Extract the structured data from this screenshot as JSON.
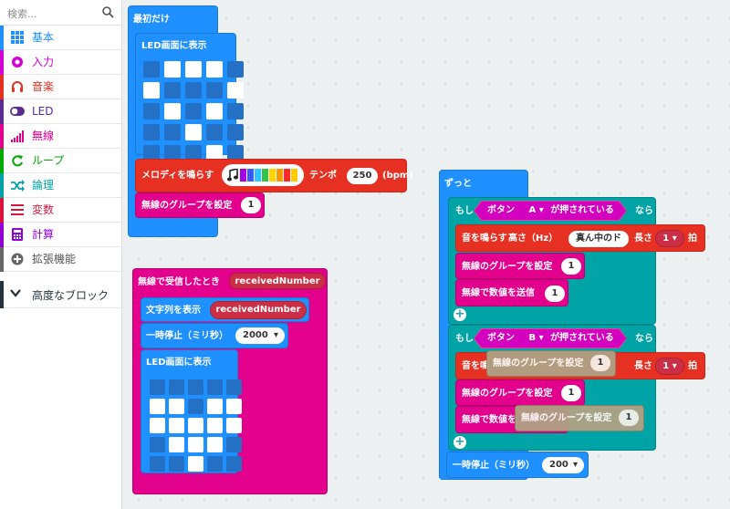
{
  "sidebar": {
    "search_placeholder": "検索...",
    "categories": [
      {
        "label": "基本",
        "color": "#1e90ff",
        "icon": "grid-icon"
      },
      {
        "label": "入力",
        "color": "#d400d4",
        "icon": "circle-dot-icon"
      },
      {
        "label": "音楽",
        "color": "#e63022",
        "icon": "headphones-icon"
      },
      {
        "label": "LED",
        "color": "#5c2d91",
        "icon": "toggle-icon"
      },
      {
        "label": "無線",
        "color": "#e3008c",
        "icon": "signal-bars-icon"
      },
      {
        "label": "ループ",
        "color": "#00aa00",
        "icon": "loop-arrow-icon"
      },
      {
        "label": "論理",
        "color": "#00a4a6",
        "icon": "shuffle-icon"
      },
      {
        "label": "変数",
        "color": "#dc143c",
        "icon": "list-lines-icon"
      },
      {
        "label": "計算",
        "color": "#9400d3",
        "icon": "calculator-icon"
      },
      {
        "label": "拡張機能",
        "color": "#666666",
        "icon": "plus-circle-icon"
      }
    ],
    "advanced_label": "高度なブロック"
  },
  "on_start": {
    "label": "最初だけ",
    "show_leds_label": "LED画面に表示",
    "leds": [
      [
        0,
        1,
        1,
        1,
        0
      ],
      [
        1,
        0,
        0,
        0,
        1
      ],
      [
        0,
        1,
        0,
        1,
        0
      ],
      [
        0,
        0,
        1,
        0,
        0
      ],
      [
        0,
        0,
        0,
        1,
        0
      ]
    ],
    "melody_label": "メロディを鳴らす",
    "tempo_label": "テンポ",
    "tempo_value": "250",
    "tempo_unit": "(bpm)",
    "set_group_label": "無線のグループを設定",
    "set_group_value": "1"
  },
  "on_received": {
    "label": "無線で受信したとき",
    "param": "receivedNumber",
    "show_string_label": "文字列を表示",
    "show_string_value": "receivedNumber",
    "pause_label": "一時停止（ミリ秒）",
    "pause_value": "2000",
    "show_leds_label": "LED画面に表示",
    "leds": [
      [
        0,
        0,
        0,
        0,
        0
      ],
      [
        1,
        1,
        0,
        1,
        1
      ],
      [
        1,
        1,
        1,
        1,
        1
      ],
      [
        0,
        1,
        1,
        1,
        0
      ],
      [
        0,
        0,
        1,
        0,
        0
      ]
    ]
  },
  "forever": {
    "label": "ずっと",
    "if_label": "もし",
    "then_label": "なら",
    "cond_a": {
      "button_label": "ボタン",
      "button": "A",
      "suffix": "が押されている"
    },
    "play_tone_label": "音を鳴らす",
    "pitch_label": "高さ（Hz）",
    "pitch_value": "真ん中のド",
    "length_label": "長さ",
    "beat_value": "1",
    "beat_unit": "拍",
    "set_group_label": "無線のグループを設定",
    "set_group_value": "1",
    "send_label": "無線で数値を送信",
    "send_value": "1",
    "cond_b": {
      "button_label": "ボタン",
      "button": "B",
      "suffix": "が押されている"
    },
    "play_tone_b_prefix": "音を鳴",
    "send_b_prefix": "無線で数値を",
    "pause_label": "一時停止（ミリ秒）",
    "pause_value": "200"
  },
  "ghosts": [
    {
      "label": "無線のグループを設定",
      "value": "1"
    },
    {
      "label": "無線のグループを設定",
      "value": "1"
    }
  ]
}
